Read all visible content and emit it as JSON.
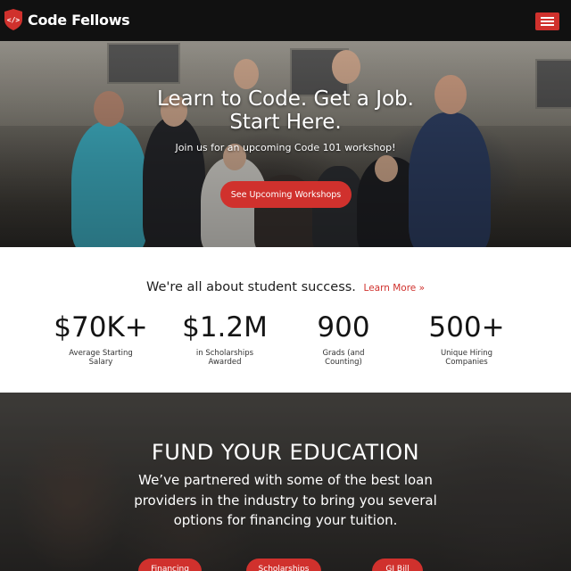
{
  "nav": {
    "brand": "Code Fellows",
    "logo_glyph": "</>",
    "menu_icon": "hamburger-menu-icon",
    "accent_color": "#d0312d"
  },
  "hero": {
    "title_line1": "Learn to Code. Get a Job.",
    "title_line2": "Start Here.",
    "subtitle": "Join us for an upcoming Code 101 workshop!",
    "cta_label": "See Upcoming Workshops"
  },
  "stats": {
    "heading": "We're all about student success.",
    "learn_more": "Learn More »",
    "items": [
      {
        "value": "$70K+",
        "label_line1": "Average Starting",
        "label_line2": "Salary"
      },
      {
        "value": "$1.2M",
        "label_line1": "in Scholarships",
        "label_line2": "Awarded"
      },
      {
        "value": "900",
        "label_line1": "Grads (and",
        "label_line2": "Counting)"
      },
      {
        "value": "500+",
        "label_line1": "Unique Hiring",
        "label_line2": "Companies"
      }
    ]
  },
  "fund": {
    "title": "FUND YOUR EDUCATION",
    "text": "We’ve partnered with some of the best loan providers in the industry to bring you several options for financing your tuition.",
    "buttons": [
      "Financing",
      "Scholarships",
      "GI Bill"
    ]
  }
}
